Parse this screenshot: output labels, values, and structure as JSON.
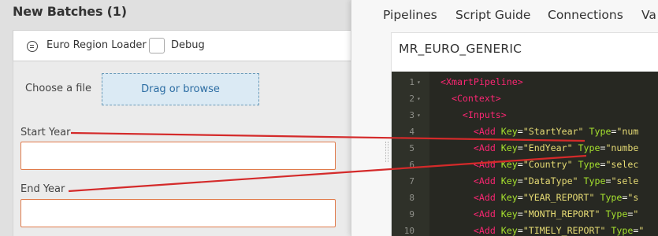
{
  "page": {
    "title": "New Batches (1)"
  },
  "pipeline": {
    "name": "Euro Region Loader",
    "debug_label": "Debug",
    "debug_checked": false
  },
  "form": {
    "choose_file_label": "Choose a file",
    "file_drop_label": "Drag or browse",
    "start_year_label": "Start Year",
    "start_year_value": "",
    "end_year_label": "End Year",
    "end_year_value": ""
  },
  "nav": {
    "items": [
      "Pipelines",
      "Script Guide",
      "Connections",
      "Va"
    ]
  },
  "script": {
    "title": "MR_EURO_GENERIC",
    "lines": [
      {
        "n": "1",
        "fold": true,
        "indent": 0,
        "tag": "<XmartPipeline>"
      },
      {
        "n": "2",
        "fold": true,
        "indent": 1,
        "tag": "<Context>"
      },
      {
        "n": "3",
        "fold": true,
        "indent": 2,
        "tag": "<Inputs>"
      },
      {
        "n": "4",
        "fold": false,
        "indent": 3,
        "tag": "<Add",
        "key": "StartYear",
        "type": "num"
      },
      {
        "n": "5",
        "fold": false,
        "indent": 3,
        "tag": "<Add",
        "key": "EndYear",
        "type": "numbe"
      },
      {
        "n": "6",
        "fold": false,
        "indent": 3,
        "tag": "<Add",
        "key": "Country",
        "type": "selec"
      },
      {
        "n": "7",
        "fold": false,
        "indent": 3,
        "tag": "<Add",
        "key": "DataType",
        "type": "sele"
      },
      {
        "n": "8",
        "fold": false,
        "indent": 3,
        "tag": "<Add",
        "key": "YEAR_REPORT",
        "type": "s"
      },
      {
        "n": "9",
        "fold": false,
        "indent": 3,
        "tag": "<Add",
        "key": "MONTH_REPORT",
        "type": ""
      },
      {
        "n": "10",
        "fold": false,
        "indent": 3,
        "tag": "<Add",
        "key": "TIMELY_REPORT",
        "type": ""
      }
    ]
  },
  "colors": {
    "annotation_line": "#d42a2a",
    "input_border": "#e07a4a",
    "drop_zone_bg": "#dbeaf4",
    "drop_zone_text": "#2c6da3",
    "editor_bg": "#272822",
    "tag": "#f92672",
    "attr": "#a6e22e",
    "string": "#e6db74"
  }
}
